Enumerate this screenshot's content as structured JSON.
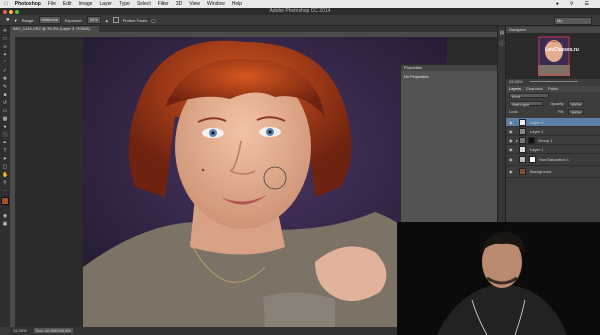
{
  "menubar": {
    "apple": "",
    "items": [
      "Photoshop",
      "File",
      "Edit",
      "Image",
      "Layer",
      "Type",
      "Select",
      "Filter",
      "3D",
      "View",
      "Window",
      "Help"
    ]
  },
  "window": {
    "title": "Adobe Photoshop CC 2014"
  },
  "options": {
    "range_label": "Range:",
    "range_value": "Midtones",
    "exposure_label": "Exposure:",
    "exposure_value": "50%",
    "protect_tones": "Protect Tones",
    "workspace": "My"
  },
  "document": {
    "tab_label": "IMG_1245.CR2 @ 33,3% (Layer 3, RGB/8)",
    "zoom": "33,33%",
    "doc_size": "Doc: 40,9M/246,5M"
  },
  "properties": {
    "title": "Properties",
    "empty_text": "No Properties"
  },
  "navigator": {
    "title": "Navigator",
    "zoom": "33,33%",
    "watermark": "LevClasses.ru"
  },
  "layers": {
    "tabs": [
      "Layers",
      "Channels",
      "Paths"
    ],
    "blend_mode": "Soft Light",
    "opacity_label": "Opacity:",
    "opacity_value": "100%",
    "lock_label": "Lock:",
    "fill_label": "Fill:",
    "fill_value": "100%",
    "items": [
      {
        "name": "Layer 3",
        "selected": true
      },
      {
        "name": "Layer 2",
        "selected": false
      },
      {
        "name": "Group 1",
        "selected": false
      },
      {
        "name": "Layer 1",
        "selected": false
      },
      {
        "name": "Hue/Saturation 1",
        "selected": false
      },
      {
        "name": "Background",
        "selected": false
      }
    ]
  },
  "colors": {
    "accent": "#5b7fa6",
    "hair": "#b8441d",
    "backdrop": "#3b2a52"
  }
}
